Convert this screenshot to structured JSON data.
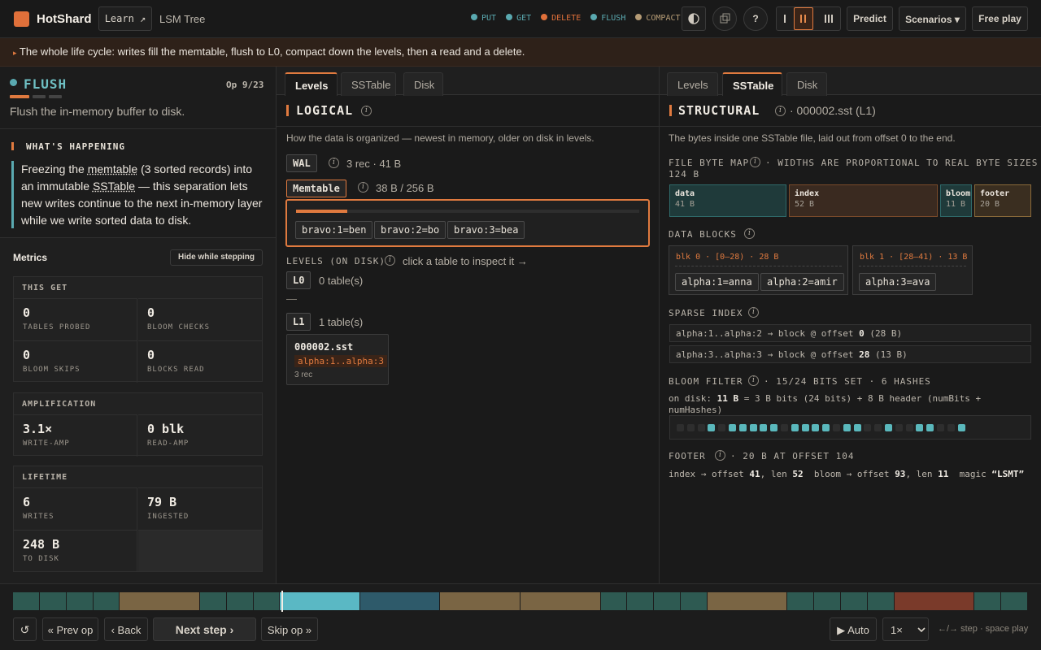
{
  "header": {
    "brand": "HotShard",
    "learn_label": "Learn ↗",
    "page_title": "LSM Tree",
    "legend": [
      {
        "label": "PUT",
        "color": "#5aa9b0"
      },
      {
        "label": "GET",
        "color": "#5aa9b0"
      },
      {
        "label": "DELETE",
        "color": "#e0703a"
      },
      {
        "label": "FLUSH",
        "color": "#5aa9b0"
      },
      {
        "label": "COMPACT",
        "color": "#b59b75"
      }
    ],
    "help_label": "?",
    "predict_label": "Predict",
    "scenarios_label": "Scenarios ▾",
    "freeplay_label": "Free play"
  },
  "banner": {
    "arrow": "▸",
    "text": "The whole life cycle: writes fill the memtable, flush to L0, compact down the levels, then a read and a delete."
  },
  "left": {
    "op_name": "FLUSH",
    "op_counter": "Op 9/23",
    "op_desc": "Flush the in-memory buffer to disk.",
    "whats_title": "WHAT'S HAPPENING",
    "whats_p1": "Freezing the ",
    "whats_link1": "memtable",
    "whats_p2": " (3 sorted records) into an immutable ",
    "whats_link2": "SSTable",
    "whats_p3": " — this separation lets new writes continue to the next in-memory layer while we write sorted data to disk.",
    "metrics_title": "Metrics",
    "hide_label": "Hide while stepping",
    "this_get_title": "THIS GET",
    "tables_probed": "0",
    "tables_probed_label": "TABLES PROBED",
    "bloom_checks": "0",
    "bloom_checks_label": "BLOOM CHECKS",
    "bloom_skips": "0",
    "bloom_skips_label": "BLOOM SKIPS",
    "blocks_read": "0",
    "blocks_read_label": "BLOCKS READ",
    "amp_title": "AMPLIFICATION",
    "write_amp": "3.1×",
    "write_amp_label": "WRITE-AMP",
    "read_amp": "0 blk",
    "read_amp_label": "READ-AMP",
    "life_title": "LIFETIME",
    "writes": "6",
    "writes_label": "WRITES",
    "ingested": "79 B",
    "ingested_label": "INGESTED",
    "to_disk": "248 B",
    "to_disk_label": "TO DISK"
  },
  "mid": {
    "tabs": [
      "Levels",
      "SSTable",
      "Disk"
    ],
    "title": "LOGICAL",
    "desc": "How the data is organized — newest in memory, older on disk in levels.",
    "wal_label": "WAL",
    "wal_info": "3 rec · 41 B",
    "memtable_label": "Memtable",
    "memtable_info": "38 B / 256 B",
    "memtable_fill": 0.15,
    "records": [
      "bravo:1=ben",
      "bravo:2=bo",
      "bravo:3=bea"
    ],
    "levels_title": "LEVELS (ON DISK)",
    "levels_hint": "click a table to inspect it →",
    "l0_label": "L0",
    "l0_info": "0 table(s)",
    "l0_empty": "—",
    "l1_label": "L1",
    "l1_info": "1 table(s)",
    "sst_name": "000002.sst",
    "sst_range": "alpha:1..alpha:3",
    "sst_recs": "3 rec"
  },
  "right": {
    "tabs": [
      "Levels",
      "SSTable",
      "Disk"
    ],
    "title": "STRUCTURAL",
    "file": "· 000002.sst (L1)",
    "desc": "The bytes inside one SSTable file, laid out from offset 0 to the end.",
    "bytemap_title": "FILE BYTE MAP",
    "bytemap_note": "· WIDTHS ARE PROPORTIONAL TO REAL BYTE SIZES ·",
    "bytemap_total": "124 B",
    "byte_segments": [
      {
        "name": "data",
        "size": "41 B",
        "bytes": 41,
        "color": "#1f3a3a",
        "border": "#2f6a6a"
      },
      {
        "name": "index",
        "size": "52 B",
        "bytes": 52,
        "color": "#3a2a20",
        "border": "#7a4a2a"
      },
      {
        "name": "bloom",
        "size": "11 B",
        "bytes": 11,
        "color": "#1f3a3a",
        "border": "#2f6a6a"
      },
      {
        "name": "footer",
        "size": "20 B",
        "bytes": 20,
        "color": "#3a2e20",
        "border": "#8a6a3a"
      }
    ],
    "blocks_title": "DATA BLOCKS",
    "blk0_head": "blk 0 · [0–28) · 28 B",
    "blk0_recs": [
      "alpha:1=anna",
      "alpha:2=amir"
    ],
    "blk1_head": "blk 1 · [28–41) · 13 B",
    "blk1_recs": [
      "alpha:3=ava"
    ],
    "sparse_title": "SPARSE INDEX",
    "sparse_rows": [
      {
        "pre": "alpha:1..alpha:2 → block @ offset ",
        "off": "0",
        "post": " (28 B)"
      },
      {
        "pre": "alpha:3..alpha:3 → block @ offset ",
        "off": "28",
        "post": " (13 B)"
      }
    ],
    "bloom_title": "BLOOM FILTER",
    "bloom_note": "· 15/24 BITS SET · 6 HASHES",
    "bloom_pre": "on disk: ",
    "bloom_bytes": "11 B",
    "bloom_post": " = 3 B bits (24 bits) + 8 B header (numBits +",
    "bloom_post2": "numHashes)",
    "bloom_bits": [
      0,
      0,
      0,
      1,
      0,
      1,
      1,
      1,
      1,
      1,
      0,
      1,
      1,
      1,
      1,
      0,
      1,
      1,
      0,
      0,
      1,
      0,
      0,
      1,
      1,
      0,
      0,
      1
    ],
    "footer_title": "FOOTER",
    "footer_note": "· 20 B AT OFFSET 104",
    "footer_line": [
      {
        "t": "index → offset ",
        "b": false
      },
      {
        "t": "41",
        "b": true
      },
      {
        "t": ", len ",
        "b": false
      },
      {
        "t": "52",
        "b": true
      },
      {
        "t": "  bloom → offset ",
        "b": false
      },
      {
        "t": "93",
        "b": true
      },
      {
        "t": ", len ",
        "b": false
      },
      {
        "t": "11",
        "b": true
      },
      {
        "t": "  magic ",
        "b": false
      },
      {
        "t": "“LSMT”",
        "b": true
      }
    ]
  },
  "timeline": {
    "ops": [
      "put",
      "put",
      "put",
      "put",
      "compact",
      "put",
      "put",
      "put",
      "flush",
      "flush",
      "compact",
      "compact",
      "put",
      "put",
      "put",
      "put",
      "compact",
      "put",
      "put",
      "put",
      "put",
      "delete",
      "put",
      "put"
    ],
    "current": 8
  },
  "controls": {
    "reset": "↺",
    "prev_op": "« Prev op",
    "back": "‹ Back",
    "next": "Next step ›",
    "skip": "Skip op »",
    "auto": "▶ Auto",
    "speed": "1×",
    "hint": "←/→ step · space play"
  }
}
